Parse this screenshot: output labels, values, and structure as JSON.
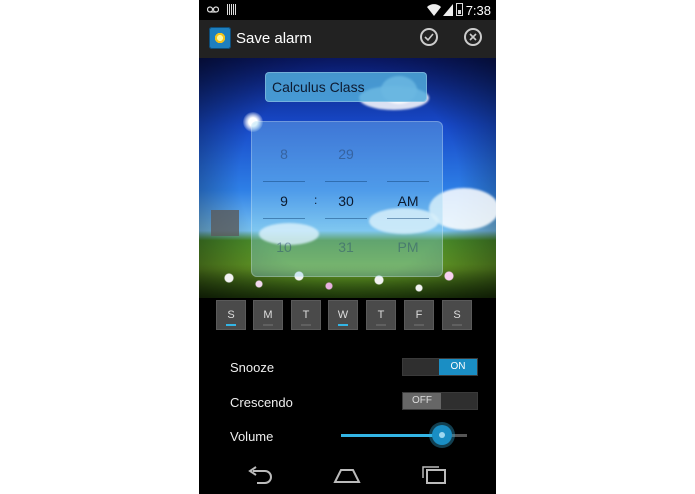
{
  "status_bar": {
    "time": "7:38"
  },
  "action_bar": {
    "title": "Save alarm"
  },
  "alarm": {
    "label": "Calculus Class"
  },
  "time_picker": {
    "hour": {
      "prev": "8",
      "current": "9",
      "next": "10"
    },
    "separator": ":",
    "minute": {
      "prev": "29",
      "current": "30",
      "next": "31"
    },
    "ampm": {
      "current": "AM",
      "next": "PM"
    }
  },
  "days": [
    {
      "label": "S",
      "selected": true
    },
    {
      "label": "M",
      "selected": false
    },
    {
      "label": "T",
      "selected": false
    },
    {
      "label": "W",
      "selected": true
    },
    {
      "label": "T",
      "selected": false
    },
    {
      "label": "F",
      "selected": false
    },
    {
      "label": "S",
      "selected": false
    }
  ],
  "settings": {
    "snooze": {
      "label": "Snooze",
      "state": "ON"
    },
    "crescendo": {
      "label": "Crescendo",
      "state": "OFF"
    },
    "volume": {
      "label": "Volume",
      "level_percent": 80
    }
  },
  "colors": {
    "accent": "#33b5e5",
    "toggle_on": "#1a8ec4",
    "background": "#000000"
  },
  "icons": [
    "voicemail-icon",
    "signal-bars-icon",
    "wifi-icon",
    "cell-signal-icon",
    "battery-icon",
    "app-icon",
    "check-icon",
    "close-icon",
    "back-icon",
    "home-icon",
    "recent-apps-icon"
  ]
}
